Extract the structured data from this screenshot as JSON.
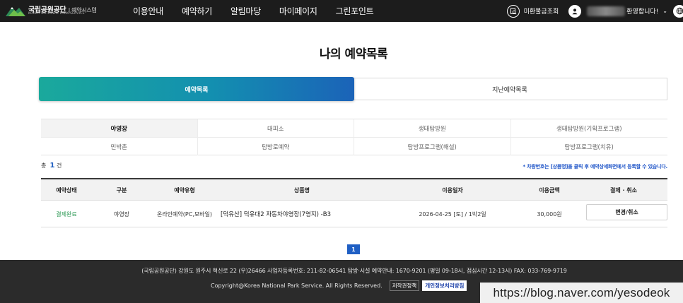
{
  "header": {
    "logo_kr": "국립공원공단",
    "logo_kr_sub": "예약시스템",
    "logo_en": "KOREA NATIONAL PARK SERVICE",
    "nav": [
      "이용안내",
      "예약하기",
      "알림마당",
      "마이페이지",
      "그린포인트"
    ],
    "unpaid_inquiry": "미환불금조회",
    "welcome": "환영합니다!",
    "welcome_caret": "⌄",
    "colors": {
      "bar": "#1c1c1c",
      "text": "#ffffff"
    },
    "icons": [
      "search-doc-icon",
      "user-icon",
      "globe-icon"
    ]
  },
  "page": {
    "title": "나의 예약목록"
  },
  "main_tabs": {
    "active": "예약목록",
    "inactive": "지난예약목록",
    "active_gradient": [
      "#1aa99c",
      "#1b63b8"
    ]
  },
  "categories": {
    "row1": [
      "야영장",
      "대피소",
      "생태탐방원",
      "생태탐방원(기획프로그램)"
    ],
    "row2": [
      "민박촌",
      "탐방로예약",
      "탐방프로그램(해설)",
      "탐방프로그램(치유)"
    ],
    "active": "야영장"
  },
  "count": {
    "prefix": "총",
    "value": "1",
    "suffix": "건"
  },
  "notice": "* 차량번호는 [상품명]을 클릭 후 예약상세화면에서 등록할 수 있습니다.",
  "table": {
    "headers": [
      "예약상태",
      "구분",
      "예약유형",
      "상품명",
      "이용일자",
      "이용금액",
      "결제 · 취소"
    ],
    "rows": [
      {
        "status": "결제완료",
        "category": "야영장",
        "type": "온라인예약(PC,모바일)",
        "product": "[덕유산] 덕유대2 자동차야영장(7영지) -B3",
        "date": "2026-04-25 [토] / 1박2일",
        "amount": "30,000원",
        "action": "변경/취소"
      }
    ],
    "status_color": "#2f9a57"
  },
  "pagination": {
    "current": "1",
    "color": "#1f5fc4"
  },
  "footer": {
    "address": "(국립공원공단) 강원도 원주시 혁신로 22 (우)26466   사업자등록번호: 211-82-06541   탐방·시설 예약안내: 1670-9201 (평일 09-18시, 점심시간 12-13시)   FAX: 033-769-9719",
    "copyright": "Copyright@Korea National Park Service. All Rights Reserved.",
    "links": [
      "저작권정책",
      "개인정보처리방침"
    ]
  },
  "watermark": "https://blog.naver.com/yesodeok"
}
